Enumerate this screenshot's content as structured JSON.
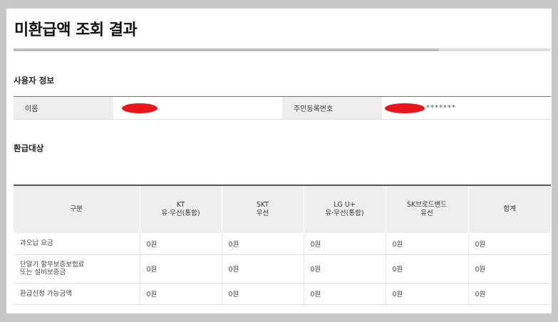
{
  "page": {
    "title": "미환급액 조회 결과"
  },
  "user_section": {
    "title": "사용자 정보",
    "name_label": "이름",
    "rrn_label": "주민등록번호",
    "rrn_masked": "*******"
  },
  "refund_section": {
    "title": "환급대상",
    "columns": [
      {
        "line1": "구분",
        "line2": ""
      },
      {
        "line1": "KT",
        "line2": "유·무선(통합)"
      },
      {
        "line1": "SKT",
        "line2": "무선"
      },
      {
        "line1": "LG U+",
        "line2": "유·무선(통합)"
      },
      {
        "line1": "SK브로드밴드",
        "line2": "유선"
      },
      {
        "line1": "합계",
        "line2": ""
      }
    ],
    "rows": [
      {
        "label1": "과오납 요금",
        "label2": "",
        "values": [
          "0원",
          "0원",
          "0원",
          "0원",
          "0원"
        ]
      },
      {
        "label1": "단말기 할부보증보험료",
        "label2": "또는 설비보증금",
        "values": [
          "0원",
          "0원",
          "0원",
          "0원",
          "0원"
        ]
      },
      {
        "label1": "환급신청 가능금액",
        "label2": "",
        "values": [
          "0원",
          "0원",
          "0원",
          "0원",
          "0원"
        ]
      }
    ]
  },
  "colors": {
    "redaction": "#e8161b",
    "header_bg": "#eeeeee",
    "page_bg": "#c8c8c8"
  }
}
